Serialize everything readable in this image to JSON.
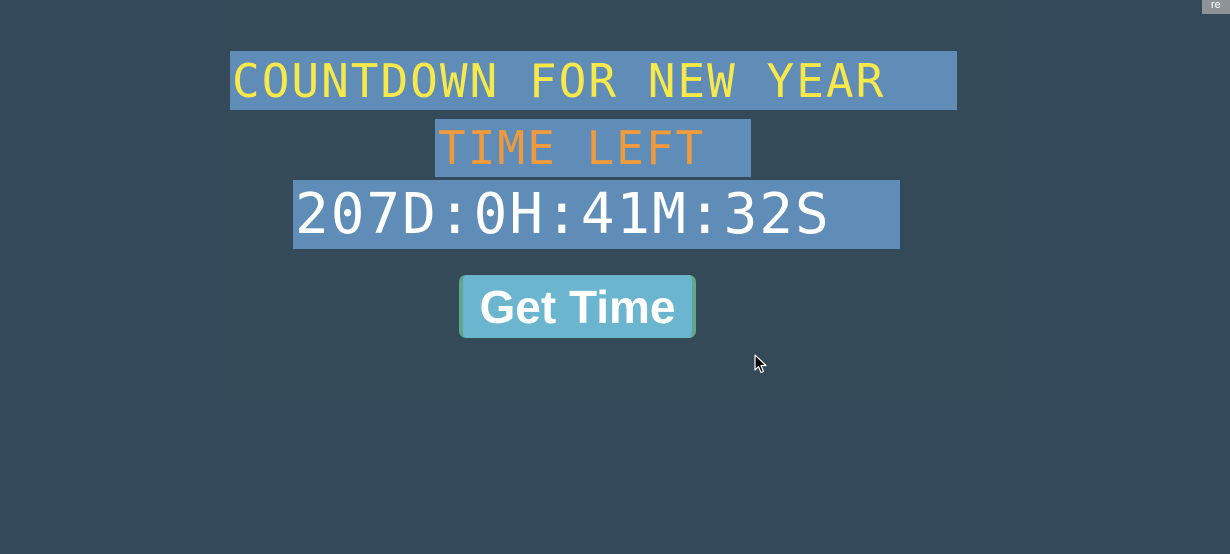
{
  "app": {
    "title": "COUNTDOWN FOR NEW YEAR",
    "subtitle": "TIME LEFT",
    "countdown": "207D:0H:41M:32S",
    "button_label": "Get Time",
    "corner_tab_text": "re"
  },
  "colors": {
    "background": "#34495a",
    "box": "#5f8db8",
    "title_text": "#f7e94a",
    "subtitle_text": "#ef9a3c",
    "countdown_text": "#ffffff",
    "button": "#6cb5cf",
    "button_border": "#5fa88a"
  },
  "icons": {
    "cursor": "mouse-pointer-icon"
  }
}
